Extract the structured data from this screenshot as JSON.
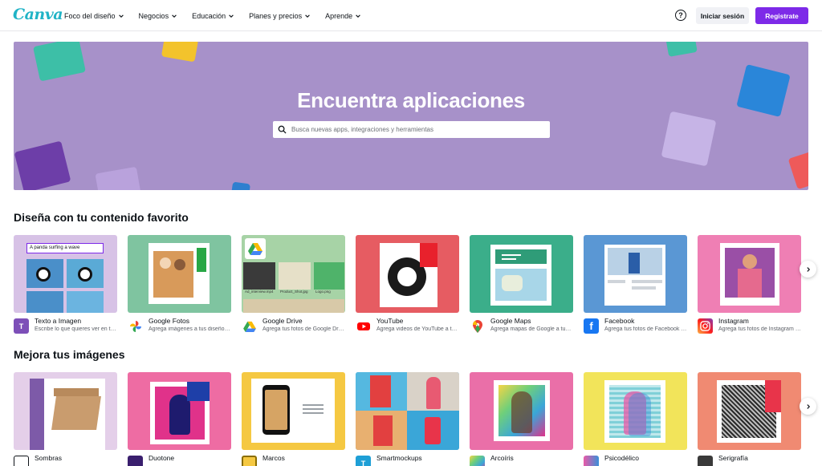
{
  "header": {
    "logo": "Canva",
    "nav": [
      {
        "label": "Foco del diseño"
      },
      {
        "label": "Negocios"
      },
      {
        "label": "Educación"
      },
      {
        "label": "Planes y precios"
      },
      {
        "label": "Aprende"
      }
    ],
    "help_glyph": "?",
    "login_label": "Iniciar sesión",
    "signup_label": "Registrate"
  },
  "hero": {
    "title": "Encuentra aplicaciones",
    "search_placeholder": "Busca nuevas apps, integraciones y herramientas"
  },
  "section1": {
    "title": "Diseña con tu contenido favorito",
    "thumb_caption": "A panda surfing a wave",
    "drive_file_1": "Ad_interview.mp4",
    "drive_file_2": "Product_Shot.jpg",
    "drive_file_3": "Logo.png",
    "apps": [
      {
        "name": "Texto a Imagen",
        "desc": "Escribe lo que quieres ver en tu diseño",
        "icon": "text-to-image-icon"
      },
      {
        "name": "Google Fotos",
        "desc": "Agrega imágenes a tus diseños desde Google Fotos",
        "icon": "google-photos-icon"
      },
      {
        "name": "Google Drive",
        "desc": "Agrega tus fotos de Google Drive a tus diseños",
        "icon": "google-drive-icon"
      },
      {
        "name": "YouTube",
        "desc": "Agrega videos de YouTube a tus diseños",
        "icon": "youtube-icon"
      },
      {
        "name": "Google Maps",
        "desc": "Agrega mapas de Google a tus diseños",
        "icon": "google-maps-icon"
      },
      {
        "name": "Facebook",
        "desc": "Agrega tus fotos de Facebook a tus diseños",
        "icon": "facebook-icon"
      },
      {
        "name": "Instagram",
        "desc": "Agrega tus fotos de Instagram a tus diseños",
        "icon": "instagram-icon"
      }
    ]
  },
  "section2": {
    "title": "Mejora tus imágenes",
    "apps": [
      {
        "name": "Sombras",
        "icon": "shadows-icon"
      },
      {
        "name": "Duotone",
        "icon": "duotone-icon"
      },
      {
        "name": "Marcos",
        "icon": "frames-icon"
      },
      {
        "name": "Smartmockups",
        "icon": "smartmockups-icon"
      },
      {
        "name": "Arcoíris",
        "icon": "rainbow-icon"
      },
      {
        "name": "Psicodélico",
        "icon": "psychedelic-icon"
      },
      {
        "name": "Serigrafía",
        "icon": "screenprint-icon"
      }
    ]
  },
  "colors": {
    "brand": "#20b3c6",
    "accent": "#7d2ae8",
    "hero_bg": "#a791c9"
  }
}
